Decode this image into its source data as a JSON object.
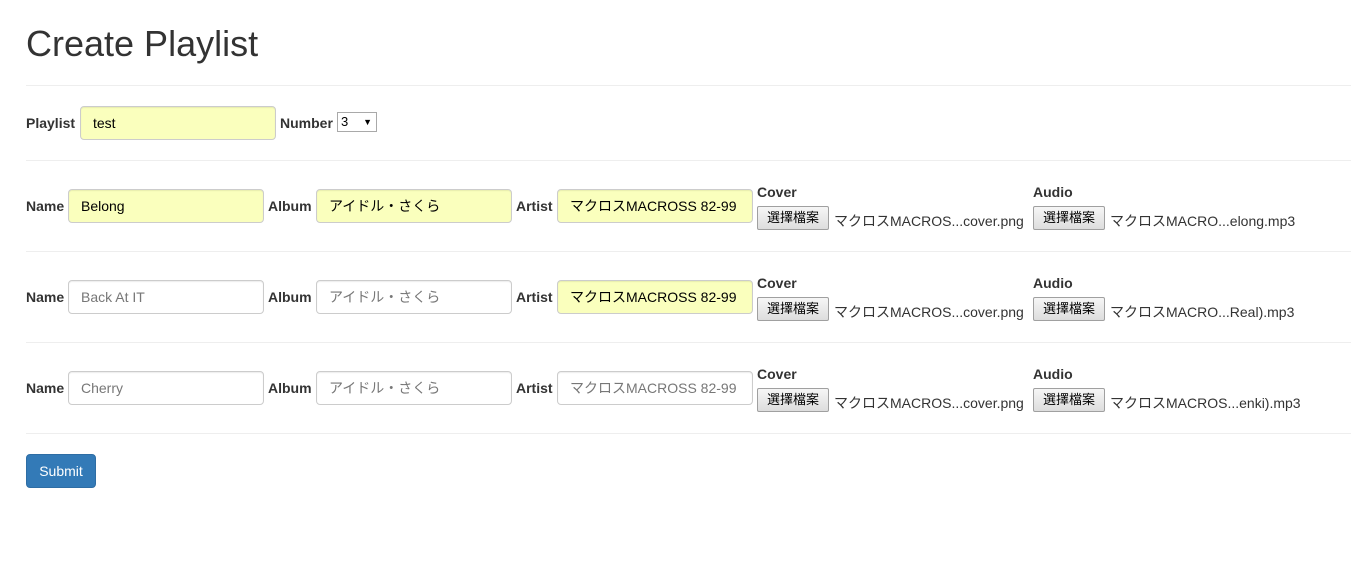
{
  "page": {
    "title": "Create Playlist"
  },
  "playlist": {
    "label": "Playlist",
    "value": "test",
    "number_label": "Number",
    "number_value": "3"
  },
  "tracks": [
    {
      "name_label": "Name",
      "name_value": "Belong",
      "album_label": "Album",
      "album_value": "アイドル・さくら",
      "artist_label": "Artist",
      "artist_value": "マクロスMACROSS 82-99",
      "cover_label": "Cover",
      "cover_button": "選擇檔案",
      "cover_file": "マクロスMACROS...cover.png",
      "audio_label": "Audio",
      "audio_button": "選擇檔案",
      "audio_file": "マクロスMACRO...elong.mp3"
    },
    {
      "name_label": "Name",
      "name_value": "Back At IT",
      "album_label": "Album",
      "album_value": "アイドル・さくら",
      "artist_label": "Artist",
      "artist_value": "マクロスMACROSS 82-99",
      "cover_label": "Cover",
      "cover_button": "選擇檔案",
      "cover_file": "マクロスMACROS...cover.png",
      "audio_label": "Audio",
      "audio_button": "選擇檔案",
      "audio_file": "マクロスMACRO...Real).mp3"
    },
    {
      "name_label": "Name",
      "name_value": "Cherry",
      "album_label": "Album",
      "album_value": "アイドル・さくら",
      "artist_label": "Artist",
      "artist_value": "マクロスMACROSS 82-99",
      "cover_label": "Cover",
      "cover_button": "選擇檔案",
      "cover_file": "マクロスMACROS...cover.png",
      "audio_label": "Audio",
      "audio_button": "選擇檔案",
      "audio_file": "マクロスMACROS...enki).mp3"
    }
  ],
  "form": {
    "submit_label": "Submit"
  },
  "colors": {
    "autofill": "#faffbd",
    "primary": "#337ab7"
  }
}
